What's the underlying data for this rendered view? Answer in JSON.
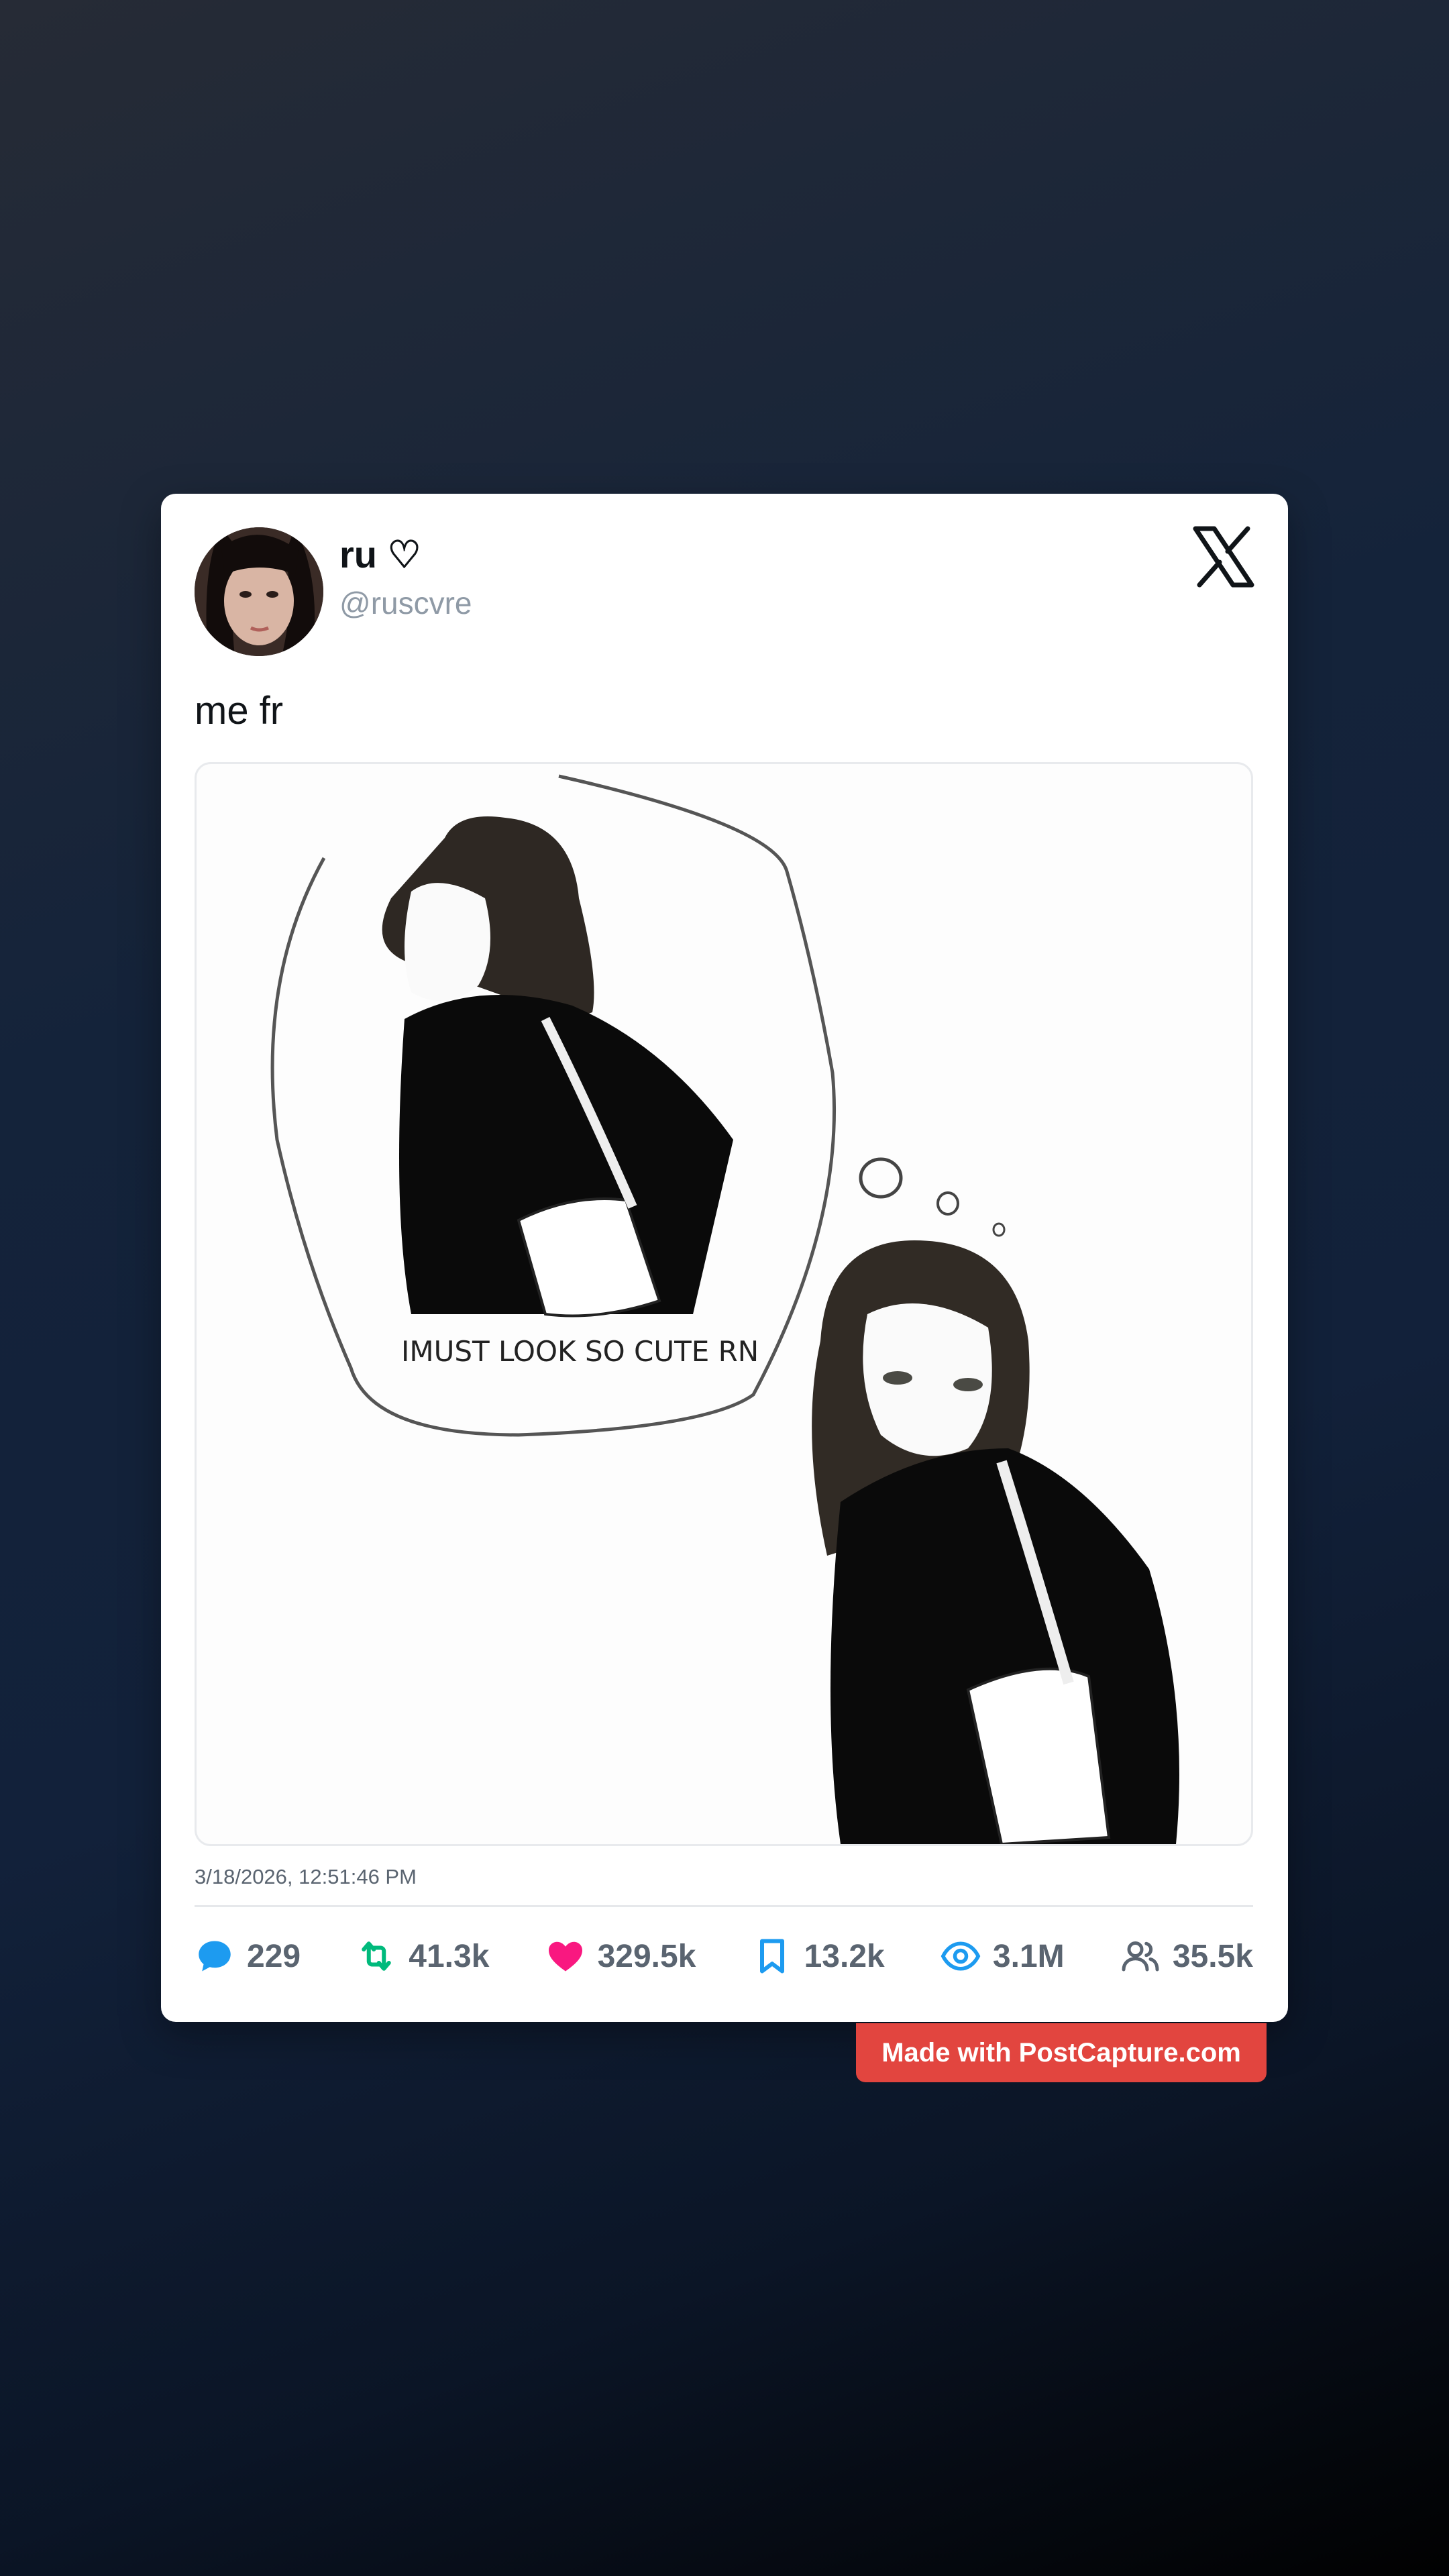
{
  "post": {
    "display_name": "ru ♡",
    "handle": "@ruscvre",
    "text": "me fr",
    "timestamp": "3/18/2026, 12:51:46 PM",
    "platform_icon": "x-logo-icon",
    "media": {
      "caption_in_image": "IMUST LOOK SO CUTE RN"
    }
  },
  "stats": {
    "replies": "229",
    "reposts": "41.3k",
    "likes": "329.5k",
    "bookmarks": "13.2k",
    "views": "3.1M",
    "followers": "35.5k"
  },
  "colors": {
    "reply": "#1d9bf0",
    "repost": "#00ba7c",
    "like": "#f91880",
    "bookmark": "#1d9bf0",
    "views": "#1d9bf0",
    "followers": "#5a6470",
    "badge": "#e2453f"
  },
  "footer": {
    "badge_label": "Made with PostCapture.com"
  }
}
